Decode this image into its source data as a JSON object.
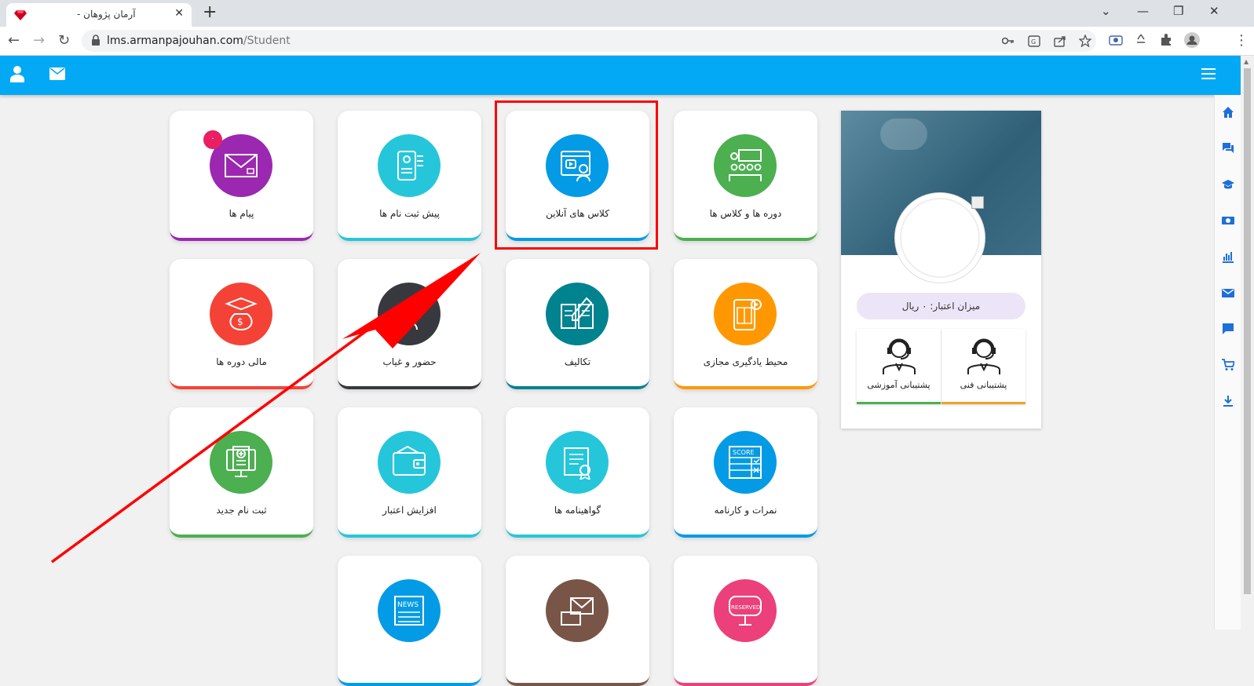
{
  "browser": {
    "tab_title": "آرمان پژوهان -",
    "url_domain": "lms.armanpajouhan.com",
    "url_path": "/Student",
    "new_tab": "+",
    "close_tab": "✕",
    "win_minimize": "—",
    "win_restore": "❐",
    "win_close": "✕",
    "win_menu": "⌄",
    "back": "←",
    "forward": "→",
    "reload": "↻",
    "menu": "⋮"
  },
  "appbar": {
    "color": "#03a9f4"
  },
  "cards": [
    {
      "label": "پیام ها",
      "color": "#9c27b0",
      "icon": "envelope-icon",
      "badge": "۰"
    },
    {
      "label": "پیش ثبت نام ها",
      "color": "#26c6da",
      "icon": "registration-scroll-icon"
    },
    {
      "label": "کلاس های آنلاین",
      "color": "#039be5",
      "icon": "online-class-icon"
    },
    {
      "label": "دوره ها و کلاس ها",
      "color": "#4caf50",
      "icon": "classroom-icon"
    },
    {
      "label": "مالی دوره ها",
      "color": "#f44336",
      "icon": "money-bag-icon"
    },
    {
      "label": "حضور و غیاب",
      "color": "#37393f",
      "icon": "attendance-icon"
    },
    {
      "label": "تکالیف",
      "color": "#00838f",
      "icon": "homework-icon"
    },
    {
      "label": "محیط یادگیری مجازی",
      "color": "#ff9800",
      "icon": "virtual-learning-icon"
    },
    {
      "label": "ثبت نام جدید",
      "color": "#4caf50",
      "icon": "new-registration-icon"
    },
    {
      "label": "افزایش اعتبار",
      "color": "#26c6da",
      "icon": "wallet-icon"
    },
    {
      "label": "گواهینامه ها",
      "color": "#26c6da",
      "icon": "certificate-icon"
    },
    {
      "label": "نمرات و کارنامه",
      "color": "#039be5",
      "icon": "score-icon"
    },
    {
      "label": "",
      "color": "#039be5",
      "icon": "news-icon",
      "text": "NEWS"
    },
    {
      "label": "",
      "color": "#795548",
      "icon": "question-mail-icon"
    },
    {
      "label": "",
      "color": "#ec407a",
      "icon": "reserved-sign-icon",
      "text": "RESERVED"
    }
  ],
  "profile": {
    "credit_text": "میزان اعتبار: ۰ ریال",
    "support_technical": "پشتیبانی فنی",
    "support_education": "پشتیبانی آموزشی",
    "support_technical_color": "#f0a030",
    "support_education_color": "#4caf50"
  },
  "score_text": "SCORE"
}
